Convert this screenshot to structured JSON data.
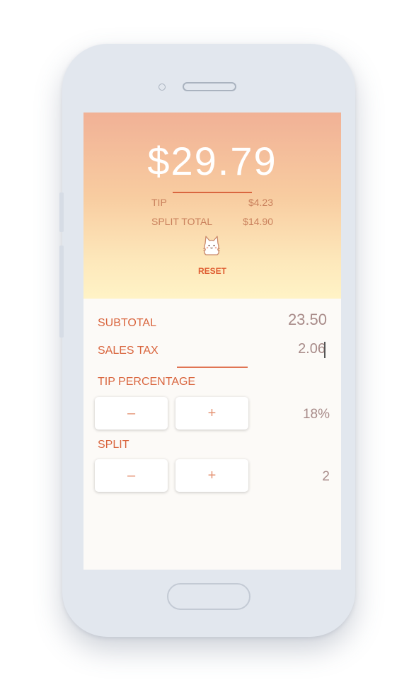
{
  "summary": {
    "total": "$29.79",
    "tip_label": "TIP",
    "tip_value": "$4.23",
    "split_total_label": "SPLIT TOTAL",
    "split_total_value": "$14.90",
    "reset_label": "RESET"
  },
  "form": {
    "subtotal_label": "SUBTOTAL",
    "subtotal_value": "23.50",
    "sales_tax_label": "SALES TAX",
    "sales_tax_value": "2.06",
    "tip_percentage_label": "TIP PERCENTAGE",
    "tip_percentage_value": "18%",
    "split_label": "SPLIT",
    "split_value": "2",
    "minus_symbol": "–",
    "plus_symbol": "+"
  },
  "icons": {
    "reset": "cat-icon"
  },
  "colors": {
    "accent": "#d9653e",
    "gradient_top": "#f1b196",
    "gradient_bottom": "#fff3c6",
    "device_body": "#e2e7ee"
  }
}
